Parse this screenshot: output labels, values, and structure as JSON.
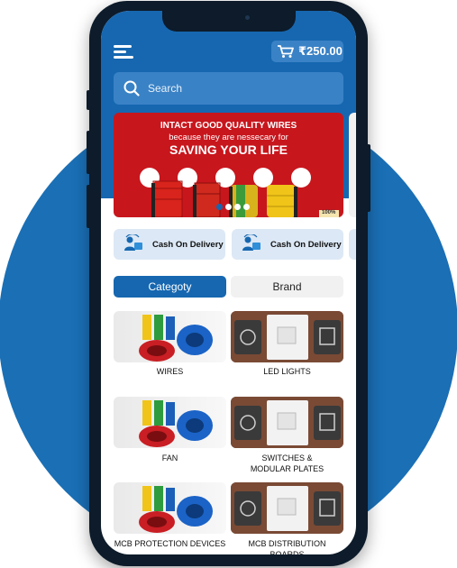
{
  "header": {
    "cart_total": "₹250.00"
  },
  "search": {
    "placeholder": "Search"
  },
  "banner": {
    "line1": "INTACT GOOD QUALITY WIRES",
    "line2": "because they are nessecary for",
    "line3": "SAVING YOUR LIFE",
    "badge": "100%"
  },
  "features": [
    {
      "label": "Cash On Delivery",
      "icon": "delivery-icon"
    },
    {
      "label": "Cash On Delivery",
      "icon": "delivery-icon"
    }
  ],
  "tabs": [
    {
      "label": "Categoty",
      "active": true
    },
    {
      "label": "Brand",
      "active": false
    }
  ],
  "categories": [
    {
      "label": "WIRES",
      "image": "wires"
    },
    {
      "label": "LED LIGHTS",
      "image": "switch-plates"
    },
    {
      "label": "FAN",
      "image": "wires"
    },
    {
      "label": "SWITCHES &",
      "label2": "MODULAR PLATES",
      "image": "switch-plates"
    },
    {
      "label": "MCB PROTECTION DEVICES",
      "image": "wires"
    },
    {
      "label": "MCB DISTRIBUTION BOARDS",
      "image": "switch-plates"
    }
  ],
  "colors": {
    "primary": "#1667b0",
    "background_circle": "#1a6fb5",
    "banner_red": "#c8161d",
    "feature_bg": "#dce8f5"
  }
}
